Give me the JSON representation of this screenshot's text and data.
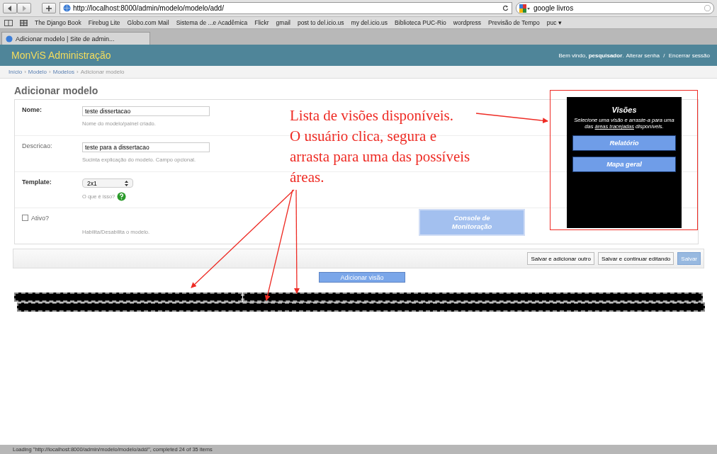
{
  "browser": {
    "url": "http://localhost:8000/admin/modelo/modelo/add/",
    "search": "google livros",
    "bookmarks": [
      "The Django Book",
      "Firebug Lite",
      "Globo.com Mail",
      "Sistema de ...e Acadêmica",
      "Flickr",
      "gmail",
      "post to del.icio.us",
      "my del.icio.us",
      "Biblioteca PUC-Rio",
      "wordpress",
      "Previsão de Tempo",
      "puc ▾"
    ],
    "tab": "Adicionar modelo | Site de admin..."
  },
  "header": {
    "title": "MonViS Administração",
    "welcome": "Bem vindo, ",
    "user": "pesquisador",
    "user_end": ".",
    "links": [
      "Alterar senha",
      "Encerrar sessão"
    ],
    "separator": " / "
  },
  "breadcrumbs": [
    "Início",
    "Modelo",
    "Modelos",
    "Adicionar modelo"
  ],
  "breadcrumb_separator": "›",
  "page_title": "Adicionar modelo",
  "fields": [
    {
      "kind": "text",
      "label": "Nome:",
      "required": true,
      "value": "teste dissertacao",
      "help": "Nome do modelo/painel criado."
    },
    {
      "kind": "text",
      "label": "Descricao:",
      "required": false,
      "value": "teste para a dissertacao",
      "help": "Sucinta explicação do modelo. Campo opcional."
    },
    {
      "kind": "select",
      "label": "Template:",
      "required": true,
      "value": "2x1",
      "help": "O que é isso?"
    },
    {
      "kind": "checkbox",
      "label": "Ativo?",
      "checked": false,
      "help": "Habilita/Desabilita o modelo."
    }
  ],
  "console_button": "Console de Monitoração",
  "submit_buttons": [
    {
      "label": "Salvar e adicionar outro",
      "default": false
    },
    {
      "label": "Salvar e continuar editando",
      "default": false
    },
    {
      "label": "Salvar",
      "default": true
    }
  ],
  "add_view_button": "Adicionar visão",
  "views_panel": {
    "title": "Visões",
    "text_before": "Selecione uma visão e arraste-a para uma das ",
    "link": "áreas tracejadas",
    "text_after": " disponíveis.",
    "items": [
      "Relatório",
      "Mapa geral"
    ]
  },
  "annotation": [
    "Lista de visões disponíveis.",
    "O usuário clica, segura e",
    "arrasta para uma das possíveis",
    "áreas."
  ],
  "status_bar": "Loading \"http://localhost:8000/admin/modelo/modelo/add/\", completed 24 of 35 items"
}
